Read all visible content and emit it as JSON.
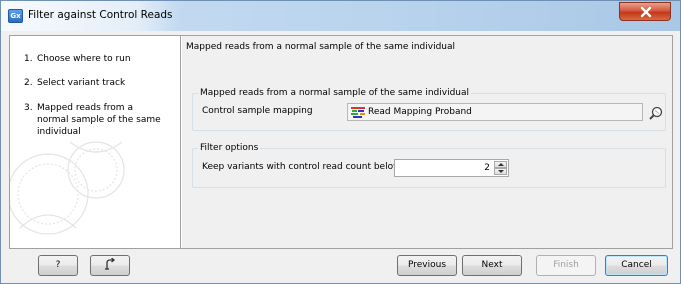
{
  "window": {
    "app_icon_text": "Gx",
    "title": "Filter against Control Reads",
    "close_icon": "close-icon"
  },
  "steps": [
    {
      "num": "1.",
      "label": "Choose where to run"
    },
    {
      "num": "2.",
      "label": "Select variant track"
    },
    {
      "num": "3.",
      "label": "Mapped reads from a normal sample of the same individual"
    }
  ],
  "panel": {
    "heading": "Mapped reads from a normal sample of the same individual",
    "mapping_group": {
      "legend": "Mapped reads from a normal sample of the same individual",
      "field_label": "Control sample mapping",
      "value": "Read Mapping Proband",
      "value_icon": "read-mapping-icon",
      "browse_icon": "browse-icon"
    },
    "filter_group": {
      "legend": "Filter options",
      "field_label": "Keep variants with control read count below",
      "value": "2"
    }
  },
  "footer": {
    "help_label": "?",
    "reset_icon": "reset-icon",
    "previous_label": "Previous",
    "next_label": "Next",
    "finish_label": "Finish",
    "cancel_label": "Cancel"
  }
}
